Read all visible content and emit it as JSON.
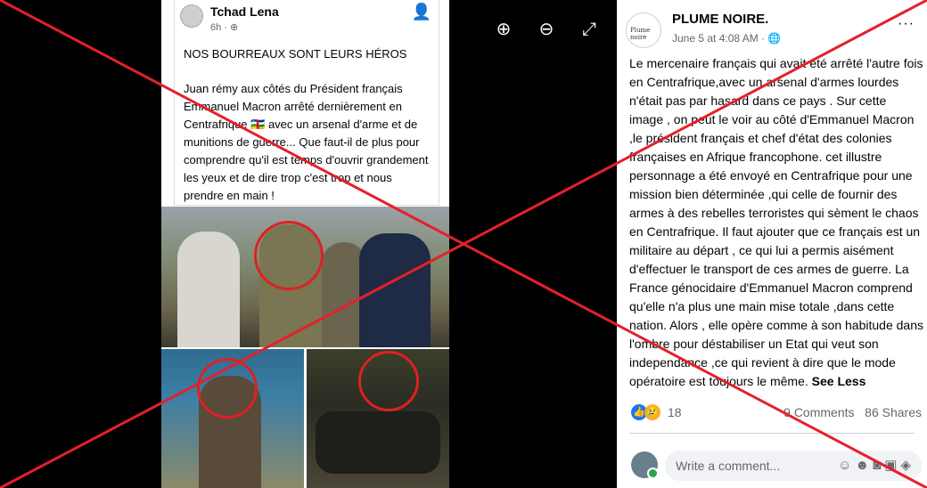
{
  "shared_post": {
    "author": "Tchad Lena",
    "time": "6h",
    "privacy_icon": "globe-icon",
    "headline": "NOS BOURREAUX SONT LEURS HÉROS",
    "body": "Juan rémy aux côtés du Président français Emmanuel Macron arrêté dernièrement en Centrafrique 🇨🇫 avec un arsenal d'arme et de munitions de guerre... Que faut-il de plus pour comprendre qu'il est temps d'ouvrir grandement les yeux et de dire trop c'est trop et nous prendre en main !"
  },
  "viewer_controls": {
    "zoom_in": "zoom-in-icon",
    "zoom_out": "zoom-out-icon",
    "fullscreen": "fullscreen-icon"
  },
  "post": {
    "page_name": "PLUME NOIRE.",
    "avatar_text": "Plume noire",
    "date": "June 5 at 4:08 AM · 🌐",
    "more": "···",
    "text": "Le mercenaire français qui avait été arrêté l'autre fois en Centrafrique,avec un arsenal d'armes lourdes n'était pas par hasard dans ce pays . Sur cette image , on peut le voir au côté d'Emmanuel Macron ,le président français et chef d'état des colonies françaises en Afrique francophone. cet illustre personnage a été envoyé en Centrafrique pour une mission bien déterminée ,qui celle de fournir des armes à des rebelles terroristes qui sèment le chaos en Centrafrique. Il faut ajouter que ce français est un militaire au départ , ce qui lui a permis aisément d'effectuer le transport de ces armes de guerre. La France génocidaire d'Emmanuel Macron comprend qu'elle n'a plus une main mise totale ,dans cette nation. Alors , elle opère comme à son habitude dans l'ombre pour déstabiliser un Etat qui veut son independance ,ce qui revient à dire que le mode opératoire est toujours le même.",
    "see_less": "See Less",
    "reaction_count": "18",
    "comments": "9 Comments",
    "shares": "86 Shares",
    "comment_placeholder": "Write a comment..."
  },
  "colors": {
    "cross": "#e5202a",
    "circle": "#e02020",
    "like": "#1877f2"
  }
}
